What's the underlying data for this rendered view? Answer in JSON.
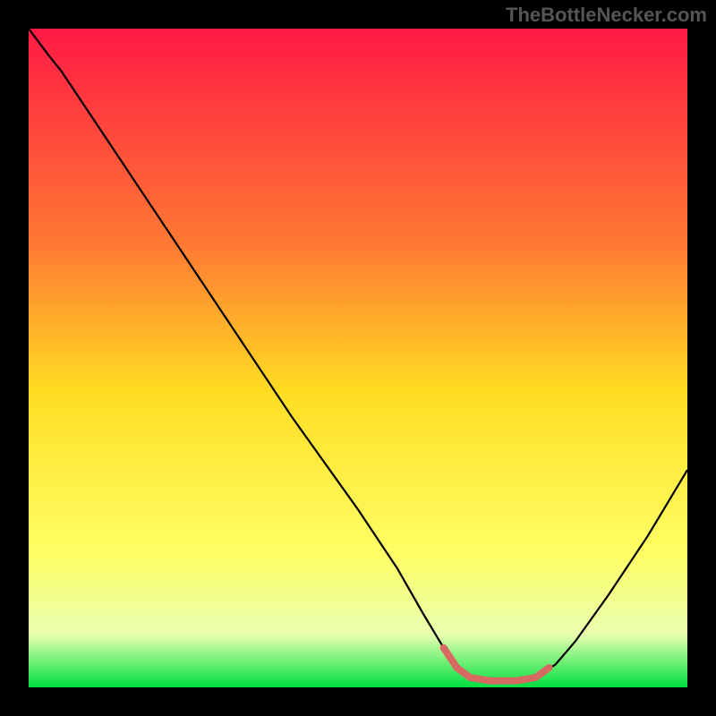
{
  "watermark": "TheBottleNecker.com",
  "chart_data": {
    "type": "line",
    "title": "",
    "xlabel": "",
    "ylabel": "",
    "xlim": [
      0,
      100
    ],
    "ylim": [
      0,
      100
    ],
    "gradient_stops": [
      {
        "offset": 0,
        "color": "#ff1a44"
      },
      {
        "offset": 33,
        "color": "#ff7a33"
      },
      {
        "offset": 55,
        "color": "#ffdd22"
      },
      {
        "offset": 80,
        "color": "#ffff66"
      },
      {
        "offset": 92,
        "color": "#e8ffb0"
      },
      {
        "offset": 100,
        "color": "#00e040"
      }
    ],
    "series": [
      {
        "name": "main-curve",
        "color": "#000000",
        "points": [
          {
            "x": 0,
            "y": 100
          },
          {
            "x": 3,
            "y": 96
          },
          {
            "x": 5,
            "y": 93.5
          },
          {
            "x": 10,
            "y": 86
          },
          {
            "x": 20,
            "y": 71
          },
          {
            "x": 30,
            "y": 56
          },
          {
            "x": 40,
            "y": 41
          },
          {
            "x": 50,
            "y": 27
          },
          {
            "x": 56,
            "y": 18
          },
          {
            "x": 60,
            "y": 11
          },
          {
            "x": 63,
            "y": 6
          },
          {
            "x": 65,
            "y": 3
          },
          {
            "x": 67,
            "y": 1.5
          },
          {
            "x": 70,
            "y": 1
          },
          {
            "x": 74,
            "y": 1
          },
          {
            "x": 77,
            "y": 1.5
          },
          {
            "x": 80,
            "y": 3.5
          },
          {
            "x": 83,
            "y": 7
          },
          {
            "x": 88,
            "y": 14
          },
          {
            "x": 94,
            "y": 23
          },
          {
            "x": 100,
            "y": 33
          }
        ]
      },
      {
        "name": "flat-highlight",
        "color": "#d66a62",
        "thickness": 8,
        "points": [
          {
            "x": 63,
            "y": 6
          },
          {
            "x": 65,
            "y": 3
          },
          {
            "x": 67,
            "y": 1.5
          },
          {
            "x": 70,
            "y": 1
          },
          {
            "x": 74,
            "y": 1
          },
          {
            "x": 77,
            "y": 1.5
          },
          {
            "x": 79,
            "y": 3
          }
        ]
      }
    ]
  }
}
